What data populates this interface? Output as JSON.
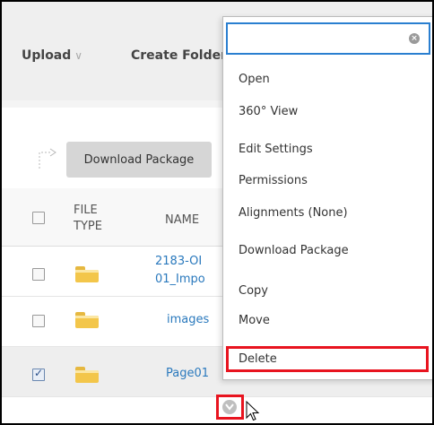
{
  "toolbar": {
    "upload_label": "Upload",
    "upload_chevron": "∨",
    "create_folder_label": "Create Folder"
  },
  "actions": {
    "download_package_label": "Download Package"
  },
  "table": {
    "header": {
      "file_type_line1": "FILE",
      "file_type_line2": "TYPE",
      "name": "NAME"
    },
    "rows": [
      {
        "name_line1": "2183-OI",
        "name_line2": "01_Impo",
        "checked": false
      },
      {
        "name_line1": "images",
        "checked": false
      },
      {
        "name_line1": "Page01",
        "checked": true
      }
    ]
  },
  "context_menu": {
    "search_value": "",
    "search_placeholder": "",
    "items": [
      "Open",
      "360° View",
      "Edit Settings",
      "Permissions",
      "Alignments (None)",
      "Download Package",
      "Copy",
      "Move",
      "Delete"
    ]
  },
  "colors": {
    "link": "#2a79bd",
    "highlight": "#e8141f",
    "search_border": "#2a7fd0",
    "folder": "#f3c64a"
  },
  "icons": [
    "folder-icon",
    "chevron-down-icon",
    "clear-search-icon",
    "mouse-pointer-icon",
    "bracket-arrow-icon"
  ]
}
